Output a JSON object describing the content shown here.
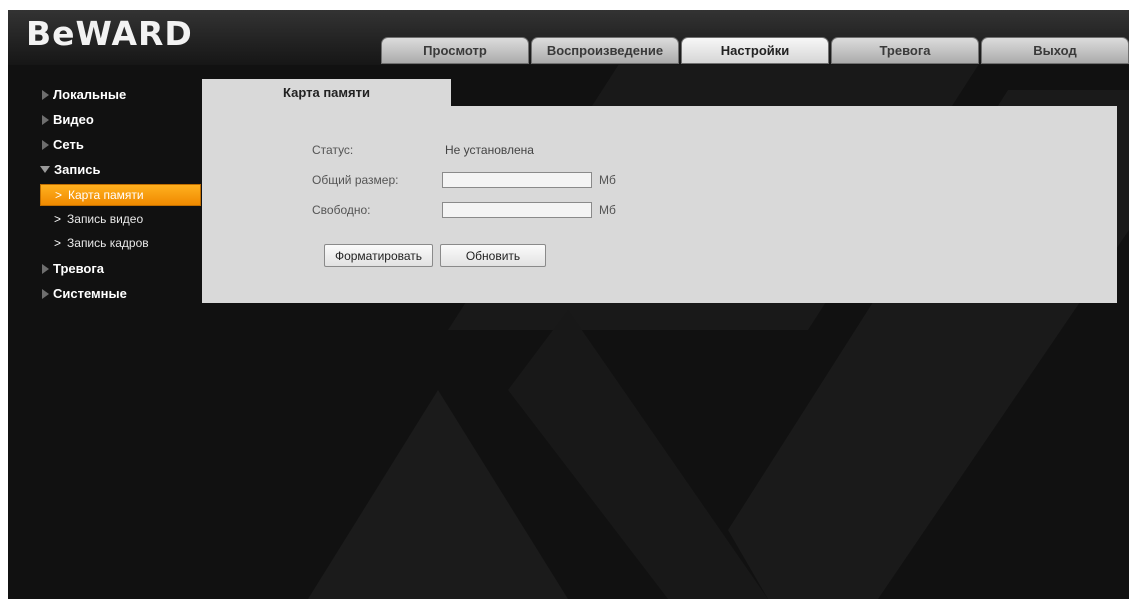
{
  "brand": {
    "logo_text": "BeWARD"
  },
  "nav": {
    "tabs": [
      {
        "label": "Просмотр",
        "active": false
      },
      {
        "label": "Воспроизведение",
        "active": false
      },
      {
        "label": "Настройки",
        "active": true
      },
      {
        "label": "Тревога",
        "active": false
      },
      {
        "label": "Выход",
        "active": false
      }
    ]
  },
  "sidebar": {
    "items": [
      {
        "label": "Локальные"
      },
      {
        "label": "Видео"
      },
      {
        "label": "Сеть"
      },
      {
        "label": "Запись",
        "expanded": true
      },
      {
        "label": "Тревога"
      },
      {
        "label": "Системные"
      }
    ],
    "sub_items": [
      {
        "label": "Карта памяти",
        "active": true
      },
      {
        "label": "Запись видео",
        "active": false
      },
      {
        "label": "Запись кадров",
        "active": false
      }
    ],
    "chevron": ">"
  },
  "content": {
    "tab_title": "Карта памяти",
    "status_label": "Статус:",
    "status_value": "Не установлена",
    "total_label": "Общий размер:",
    "total_value": "",
    "total_unit": "Мб",
    "free_label": "Свободно:",
    "free_value": "",
    "free_unit": "Мб",
    "format_button": "Форматировать",
    "refresh_button": "Обновить"
  },
  "colors": {
    "background": "#111111",
    "accent": "#f7a00e",
    "panel": "#d9d9d9"
  },
  "icons": {
    "collapsed": "triangle-right-icon",
    "expanded": "triangle-down-icon",
    "sub": "chevron-right-icon"
  }
}
